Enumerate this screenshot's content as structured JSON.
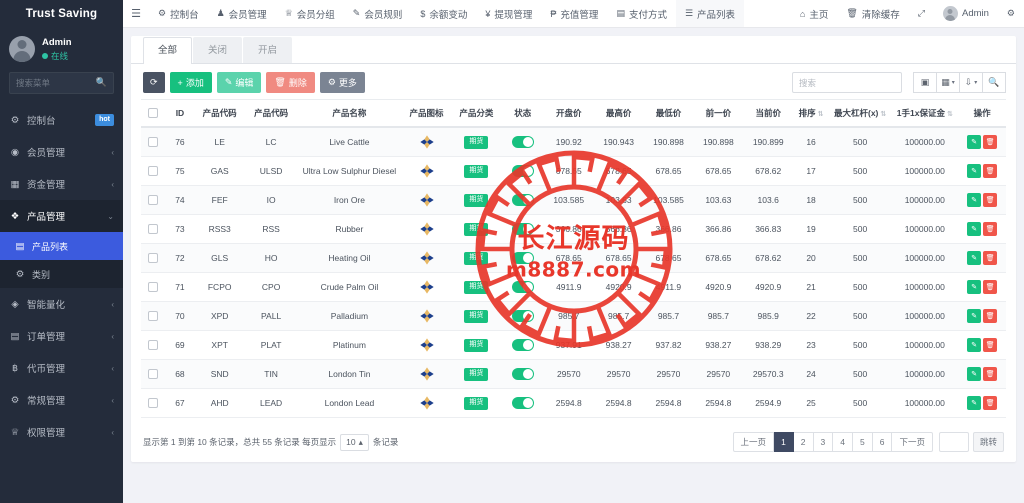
{
  "brand": {
    "title": "Trust Saving"
  },
  "user": {
    "name": "Admin",
    "status": "在线"
  },
  "sidebar": {
    "search_placeholder": "搜索菜单",
    "items": [
      {
        "label": "控制台",
        "icon": "dashboard-icon",
        "badge": "hot",
        "caret": ""
      },
      {
        "label": "会员管理",
        "icon": "user-icon",
        "badge": "",
        "caret": "‹"
      },
      {
        "label": "资金管理",
        "icon": "money-icon",
        "badge": "",
        "caret": "‹"
      },
      {
        "label": "产品管理",
        "icon": "product-icon",
        "badge": "",
        "caret": "⌄"
      }
    ],
    "sub_items": [
      {
        "label": "产品列表",
        "icon": "list-icon",
        "active": true
      },
      {
        "label": "类别",
        "icon": "gear-icon",
        "active": false
      }
    ],
    "items_after": [
      {
        "label": "智能量化",
        "icon": "quant-icon",
        "caret": "‹"
      },
      {
        "label": "订单管理",
        "icon": "order-icon",
        "caret": "‹"
      },
      {
        "label": "代币管理",
        "icon": "token-icon",
        "caret": "‹"
      },
      {
        "label": "常规管理",
        "icon": "settings-icon",
        "caret": "‹"
      },
      {
        "label": "权限管理",
        "icon": "permission-icon",
        "caret": "‹"
      }
    ]
  },
  "topnav": {
    "hamburger": "☰",
    "items": [
      {
        "label": "控制台",
        "icon": "dashboard-icon",
        "glyph": "⚙",
        "selected": false
      },
      {
        "label": "会员管理",
        "icon": "user-icon",
        "glyph": "👤",
        "selected": false
      },
      {
        "label": "会员分组",
        "icon": "group-icon",
        "glyph": "👥",
        "selected": false
      },
      {
        "label": "会员规则",
        "icon": "rule-icon",
        "glyph": "✎",
        "selected": false
      },
      {
        "label": "余额变动",
        "icon": "dollar-icon",
        "glyph": "$",
        "selected": false
      },
      {
        "label": "提现管理",
        "icon": "yen-icon",
        "glyph": "¥",
        "selected": false
      },
      {
        "label": "充值管理",
        "icon": "recharge-icon",
        "glyph": "₱",
        "selected": false
      },
      {
        "label": "支付方式",
        "icon": "card-icon",
        "glyph": "▤",
        "selected": false
      },
      {
        "label": "产品列表",
        "icon": "list-icon",
        "glyph": "☰",
        "selected": true
      }
    ],
    "right": [
      {
        "label": "主页",
        "icon": "home-icon",
        "glyph": "⌂"
      },
      {
        "label": "清除缓存",
        "icon": "trash-icon",
        "glyph": "🗑"
      },
      {
        "label": "",
        "icon": "fullscreen-icon",
        "glyph": "⤢"
      },
      {
        "label": "Admin",
        "icon": "avatar-icon",
        "glyph": ""
      },
      {
        "label": "",
        "icon": "settings-icon",
        "glyph": "⚙"
      }
    ]
  },
  "tabs": [
    {
      "label": "全部",
      "active": true
    },
    {
      "label": "关闭",
      "active": false
    },
    {
      "label": "开启",
      "active": false
    }
  ],
  "toolbar": {
    "refresh_label": "⟳",
    "add_label": "添加",
    "edit_label": "编辑",
    "delete_label": "删除",
    "more_label": "更多",
    "search_placeholder": "搜索",
    "icon_buttons": [
      {
        "name": "columns-toggle-icon",
        "glyph": "▣",
        "caret": ""
      },
      {
        "name": "grid-view-icon",
        "glyph": "▦",
        "caret": "▾"
      },
      {
        "name": "export-icon",
        "glyph": "⇩",
        "caret": "▾"
      },
      {
        "name": "search-icon",
        "glyph": "🔍",
        "caret": ""
      }
    ]
  },
  "table": {
    "columns": [
      {
        "label": "",
        "name": "select-all",
        "sortable": false,
        "width": "3.2%"
      },
      {
        "label": "ID",
        "name": "id",
        "sortable": false,
        "width": "3.6%"
      },
      {
        "label": "产品代码",
        "name": "product-code-1",
        "sortable": false,
        "width": "6.6%"
      },
      {
        "label": "产品代码",
        "name": "product-code-2",
        "sortable": false,
        "width": "6.6%"
      },
      {
        "label": "产品名称",
        "name": "product-name",
        "sortable": false,
        "width": "13.5%"
      },
      {
        "label": "产品图标",
        "name": "product-icon",
        "sortable": false,
        "width": "6.3%"
      },
      {
        "label": "产品分类",
        "name": "product-category",
        "sortable": false,
        "width": "6.5%"
      },
      {
        "label": "状态",
        "name": "status",
        "sortable": false,
        "width": "5.4%"
      },
      {
        "label": "开盘价",
        "name": "open-price",
        "sortable": false,
        "width": "6.4%"
      },
      {
        "label": "最高价",
        "name": "high-price",
        "sortable": false,
        "width": "6.4%"
      },
      {
        "label": "最低价",
        "name": "low-price",
        "sortable": false,
        "width": "6.4%"
      },
      {
        "label": "前一价",
        "name": "prev-price",
        "sortable": false,
        "width": "6.4%"
      },
      {
        "label": "当前价",
        "name": "current-price",
        "sortable": false,
        "width": "6.4%"
      },
      {
        "label": "排序",
        "name": "sort-order",
        "sortable": true,
        "width": "4.6%"
      },
      {
        "label": "最大杠杆(x)",
        "name": "max-leverage",
        "sortable": true,
        "width": "8.0%"
      },
      {
        "label": "1手1x保证金",
        "name": "margin-per-lot",
        "sortable": true,
        "width": "8.6%"
      },
      {
        "label": "操作",
        "name": "actions",
        "sortable": false,
        "width": "6.1%"
      }
    ],
    "rows": [
      {
        "id": "76",
        "code1": "LE",
        "code2": "LC",
        "name": "Live Cattle",
        "category": "期货",
        "status_on": true,
        "open": "190.92",
        "high": "190.943",
        "low": "190.898",
        "prev": "190.898",
        "current": "190.899",
        "sort": "16",
        "leverage": "500",
        "margin": "100000.00"
      },
      {
        "id": "75",
        "code1": "GAS",
        "code2": "ULSD",
        "name": "Ultra Low Sulphur Diesel",
        "category": "期货",
        "status_on": true,
        "open": "678.65",
        "high": "678.65",
        "low": "678.65",
        "prev": "678.65",
        "current": "678.62",
        "sort": "17",
        "leverage": "500",
        "margin": "100000.00"
      },
      {
        "id": "74",
        "code1": "FEF",
        "code2": "IO",
        "name": "Iron Ore",
        "category": "期货",
        "status_on": true,
        "open": "103.585",
        "high": "103.63",
        "low": "103.585",
        "prev": "103.63",
        "current": "103.6",
        "sort": "18",
        "leverage": "500",
        "margin": "100000.00"
      },
      {
        "id": "73",
        "code1": "RSS3",
        "code2": "RSS",
        "name": "Rubber",
        "category": "期货",
        "status_on": true,
        "open": "366.86",
        "high": "366.86",
        "low": "366.86",
        "prev": "366.86",
        "current": "366.83",
        "sort": "19",
        "leverage": "500",
        "margin": "100000.00"
      },
      {
        "id": "72",
        "code1": "GLS",
        "code2": "HO",
        "name": "Heating Oil",
        "category": "期货",
        "status_on": true,
        "open": "678.65",
        "high": "678.65",
        "low": "678.65",
        "prev": "678.65",
        "current": "678.62",
        "sort": "20",
        "leverage": "500",
        "margin": "100000.00"
      },
      {
        "id": "71",
        "code1": "FCPO",
        "code2": "CPO",
        "name": "Crude Palm Oil",
        "category": "期货",
        "status_on": true,
        "open": "4911.9",
        "high": "4920.9",
        "low": "4911.9",
        "prev": "4920.9",
        "current": "4920.9",
        "sort": "21",
        "leverage": "500",
        "margin": "100000.00"
      },
      {
        "id": "70",
        "code1": "XPD",
        "code2": "PALL",
        "name": "Palladium",
        "category": "期货",
        "status_on": true,
        "open": "985.7",
        "high": "985.7",
        "low": "985.7",
        "prev": "985.7",
        "current": "985.9",
        "sort": "22",
        "leverage": "500",
        "margin": "100000.00"
      },
      {
        "id": "69",
        "code1": "XPT",
        "code2": "PLAT",
        "name": "Platinum",
        "category": "期货",
        "status_on": true,
        "open": "937.91",
        "high": "938.27",
        "low": "937.82",
        "prev": "938.27",
        "current": "938.29",
        "sort": "23",
        "leverage": "500",
        "margin": "100000.00"
      },
      {
        "id": "68",
        "code1": "SND",
        "code2": "TIN",
        "name": "London Tin",
        "category": "期货",
        "status_on": true,
        "open": "29570",
        "high": "29570",
        "low": "29570",
        "prev": "29570",
        "current": "29570.3",
        "sort": "24",
        "leverage": "500",
        "margin": "100000.00"
      },
      {
        "id": "67",
        "code1": "AHD",
        "code2": "LEAD",
        "name": "London Lead",
        "category": "期货",
        "status_on": true,
        "open": "2594.8",
        "high": "2594.8",
        "low": "2594.8",
        "prev": "2594.8",
        "current": "2594.9",
        "sort": "25",
        "leverage": "500",
        "margin": "100000.00"
      }
    ]
  },
  "footer": {
    "info_text": "显示第 1 到第 10 条记录，总共 55 条记录 每页显示",
    "page_size": "10",
    "info_suffix": "条记录",
    "prev_label": "上一页",
    "next_label": "下一页",
    "pages": [
      "1",
      "2",
      "3",
      "4",
      "5",
      "6"
    ],
    "current_page": "1",
    "jump_value": "",
    "jump_label": "跳转"
  },
  "watermark": {
    "line1": "长江源码",
    "line2": "m8887.com",
    "color": "#e8372b"
  }
}
